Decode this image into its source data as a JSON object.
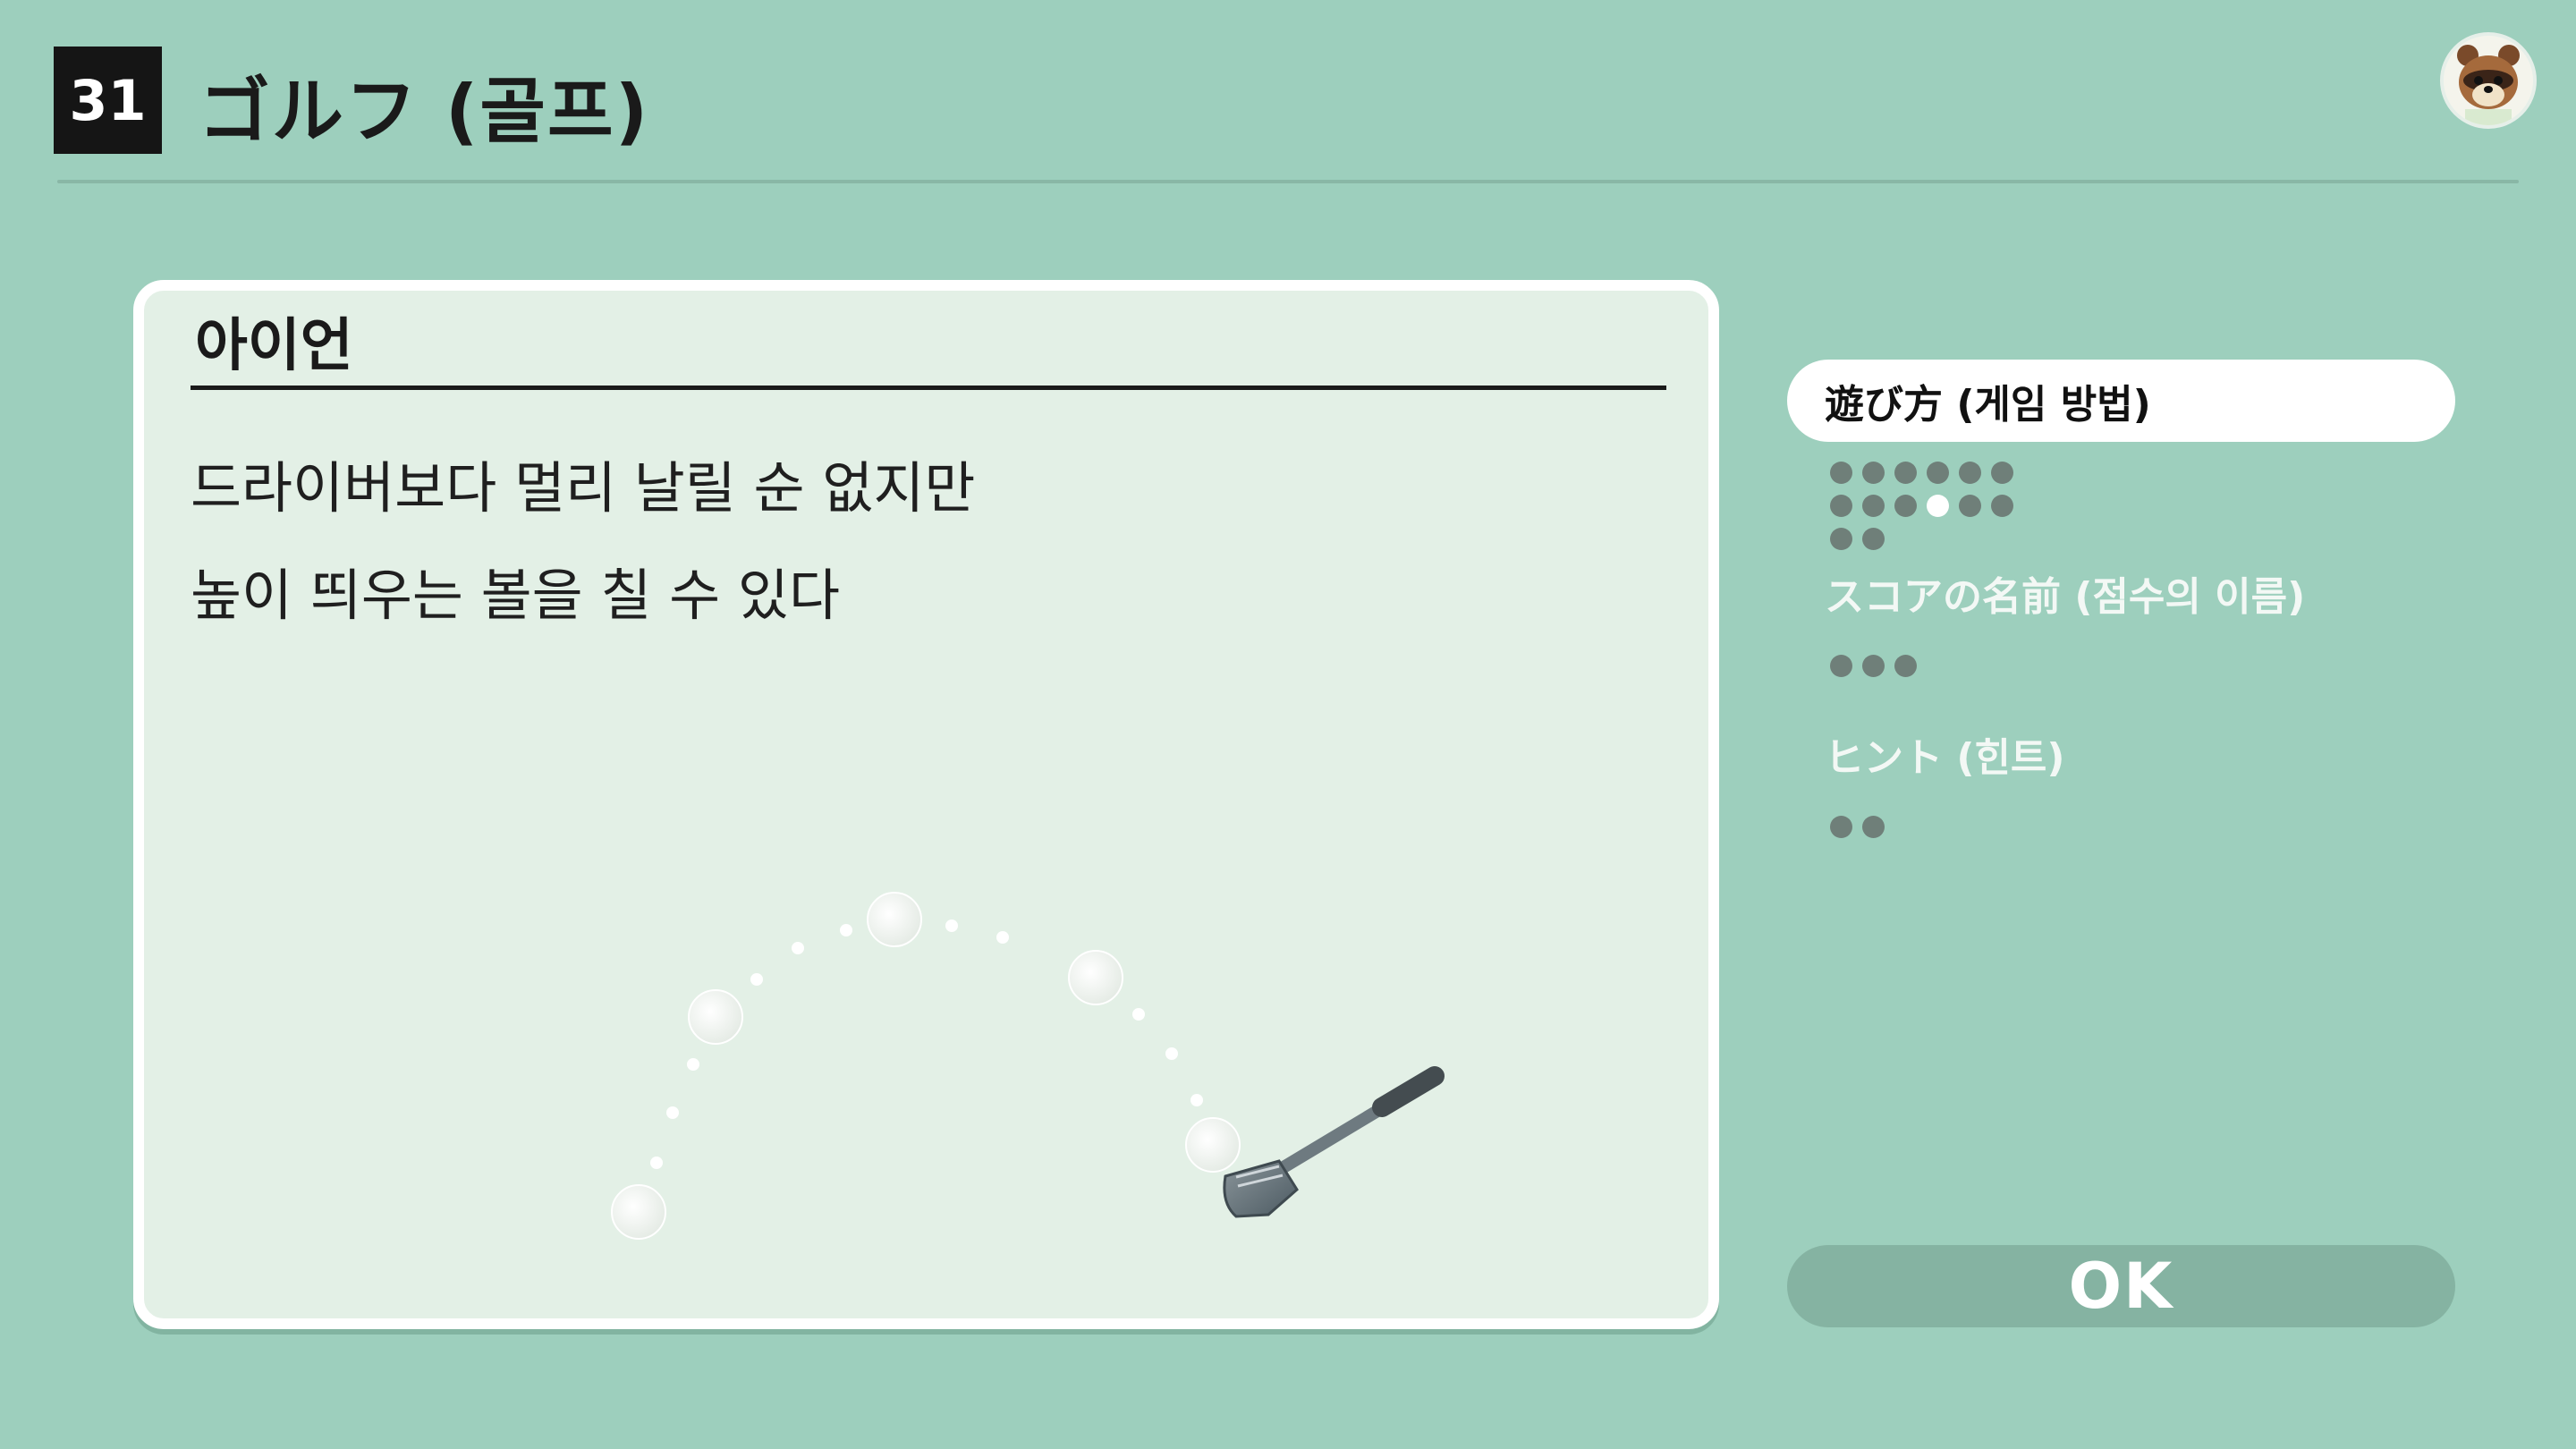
{
  "header": {
    "number": "31",
    "title": "ゴルフ (골프)"
  },
  "card": {
    "title": "아이언",
    "lines": [
      "드라이버보다 멀리 날릴 순 없지만",
      "높이 띄우는 볼을 칠 수 있다"
    ]
  },
  "menu": {
    "items": [
      {
        "label": "遊び方 (게임 방법)",
        "active": true,
        "pages": 14,
        "current_page": 10
      },
      {
        "label": "スコアの名前 (점수의 이름)",
        "active": false,
        "pages": 3,
        "current_page": null
      },
      {
        "label": "ヒント (힌트)",
        "active": false,
        "pages": 2,
        "current_page": null
      }
    ]
  },
  "ok_button": {
    "label": "OK"
  },
  "colors": {
    "background": "#9dcfbd",
    "card": "#e3f0e6",
    "ok_button": "#85b3a2",
    "dot": "#6f7f79",
    "dot_active": "#ffffff"
  },
  "icons": {
    "avatar": "tom-nook-avatar-icon",
    "illustration": "golf-iron-club-icon"
  }
}
